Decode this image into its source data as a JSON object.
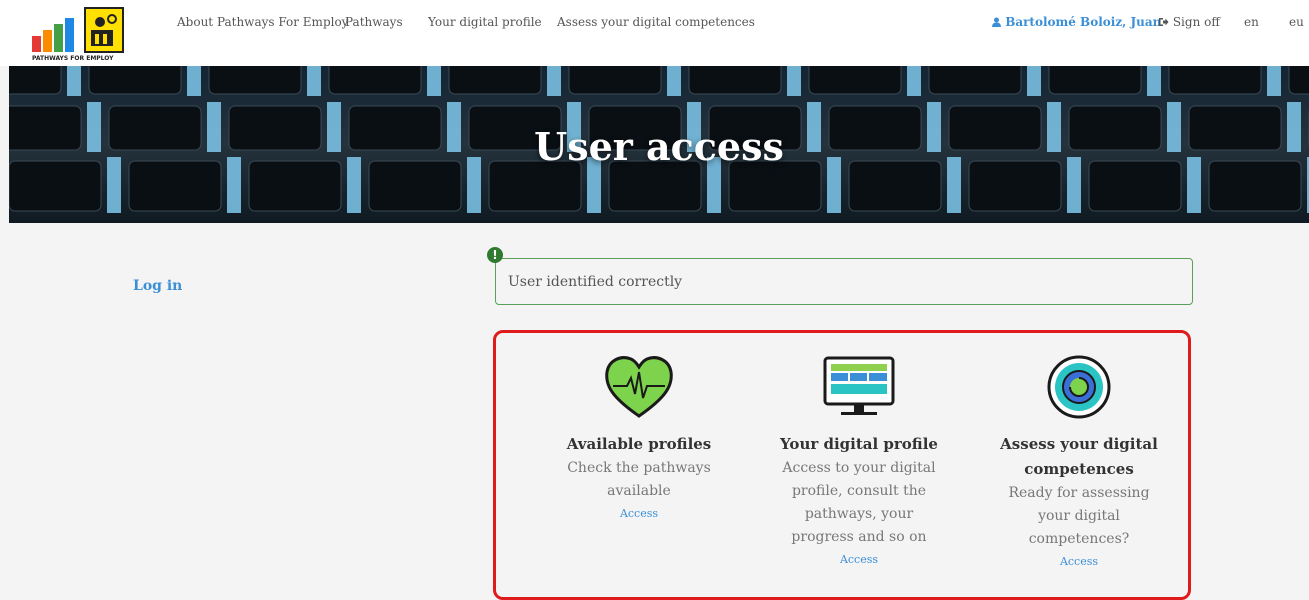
{
  "header": {
    "logo_text": "PATHWAYS FOR EMPLOY",
    "nav": [
      {
        "label": "About Pathways For Employ"
      },
      {
        "label": "Pathways"
      },
      {
        "label": "Your digital profile"
      },
      {
        "label": "Assess your digital competences"
      }
    ],
    "user_name": "Bartolomé Boloiz, Juan",
    "user_icon": "user-icon",
    "sign_off": "Sign off",
    "sign_off_icon": "sign-out-icon",
    "languages": [
      "en",
      "eu"
    ]
  },
  "hero": {
    "title": "User access"
  },
  "sidebar": {
    "login": "Log in"
  },
  "alert": {
    "text": "User identified correctly",
    "icon": "exclamation-icon",
    "color": "#2f7a2f"
  },
  "highlight_color": "#e01b1b",
  "accent_color": "#3b8fd6",
  "cards": [
    {
      "icon": "heart-pulse-icon",
      "title": "Available profiles",
      "description": "Check the pathways available",
      "link": "Access"
    },
    {
      "icon": "monitor-icon",
      "title": "Your digital profile",
      "description": "Access to your digital profile, consult the pathways, your progress and so on",
      "link": "Access"
    },
    {
      "icon": "target-icon",
      "title": "Assess your digital competences",
      "description": "Ready for assessing your digital competences?",
      "link": "Access"
    }
  ]
}
